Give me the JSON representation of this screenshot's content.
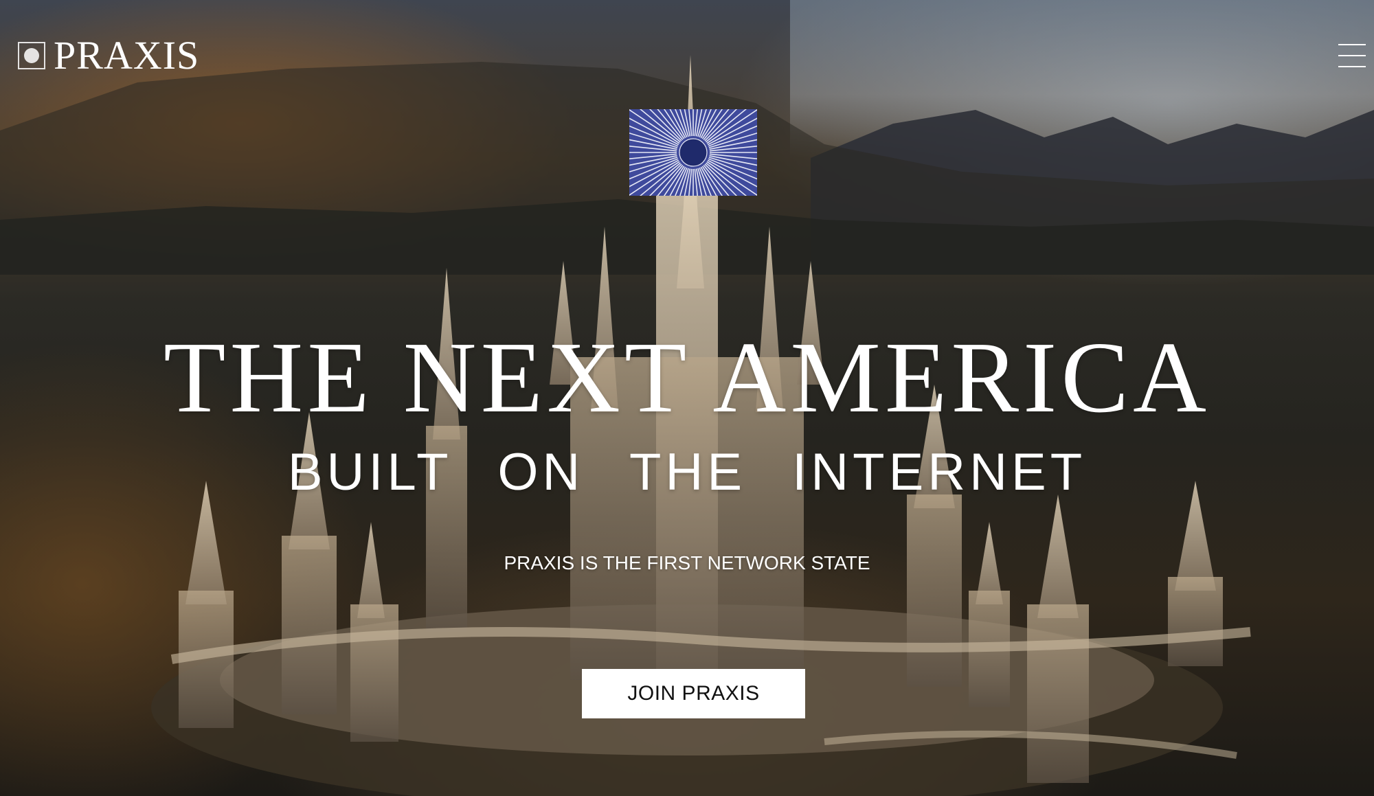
{
  "header": {
    "logo_text": "PRAXIS",
    "menu_icon": "hamburger-menu-icon"
  },
  "emblem": {
    "icon": "sunburst-emblem-icon",
    "colors": {
      "background": "#3f4a9c",
      "rays": "#e6e8f5",
      "center": "#1f2a6b"
    }
  },
  "hero": {
    "title": "THE NEXT AMERICA",
    "subtitle": "BUILT ON THE INTERNET",
    "tagline": "PRAXIS IS THE FIRST NETWORK STATE",
    "cta_label": "JOIN PRAXIS"
  },
  "colors": {
    "text": "#ffffff",
    "button_background": "#ffffff",
    "button_text": "#111111"
  }
}
